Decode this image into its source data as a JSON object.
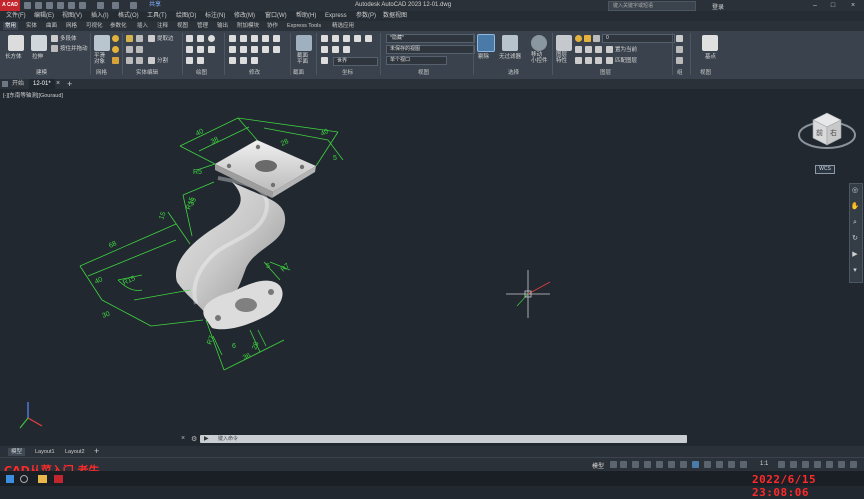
{
  "app": {
    "logo": "A CAD",
    "share": "共享",
    "title": "Autodesk AutoCAD 2023   12-01.dwg",
    "search_placeholder": "键入关键字或短语",
    "login": "登录"
  },
  "menus": [
    "文件(F)",
    "编辑(E)",
    "视图(V)",
    "插入(I)",
    "格式(O)",
    "工具(T)",
    "绘图(D)",
    "标注(N)",
    "修改(M)",
    "窗口(W)",
    "帮助(H)",
    "Express",
    "参数(P)",
    "数据视图"
  ],
  "ribbon_tabs": [
    "常用",
    "实体",
    "曲面",
    "网格",
    "可视化",
    "参数化",
    "插入",
    "注释",
    "视图",
    "管理",
    "输出",
    "附加模块",
    "协作",
    "Express Tools",
    "精选应用"
  ],
  "ribbon": {
    "modeling": {
      "box": "长方体",
      "extrude": "拉伸",
      "polysolid": "多段体",
      "presspull": "按住并拖动",
      "group": "建模"
    },
    "mesh": {
      "smooth": "平滑\n对象",
      "group": "网格"
    },
    "solid_edit": {
      "group": "实体编辑",
      "extract": "提取边",
      "split": "分割"
    },
    "draw": {
      "group": "绘图"
    },
    "modify": {
      "group": "修改"
    },
    "section": {
      "label": "截面\n平面",
      "group": "截面"
    },
    "coords": {
      "group": "坐标",
      "world": "世界"
    },
    "view": {
      "visual_style": "*隐藏*",
      "saved_view": "未保存的视图",
      "viewport": "单个视口",
      "group": "视图"
    },
    "selection": {
      "culling": "剔除",
      "nofilter": "无过滤器",
      "gizmo": "移动\n小控件",
      "group": "选择"
    },
    "layers": {
      "props": "图层\n特性",
      "layer_value": "0",
      "match": "置为当前",
      "match_layer": "匹配图层",
      "group": "图层"
    },
    "groups": {
      "group": "组"
    },
    "view2": {
      "base": "基点",
      "group": "视图"
    }
  },
  "doc_tabs": [
    "开始",
    "12-01*"
  ],
  "viewport_label": "[-][东南等轴测][Gouraud]",
  "viewcube": {
    "face": "前",
    "right": "右",
    "wcs": "WCS"
  },
  "command": {
    "placeholder": "键入命令"
  },
  "layout_tabs": [
    "模型",
    "Layout1",
    "Layout2"
  ],
  "status": {
    "model": "模型",
    "scale": "1:1"
  },
  "overlay_text": "CAD从菜入门 老牛",
  "timestamp": "2022/6/15 23:08:06",
  "dims": [
    "40",
    "38",
    "28",
    "40",
    "R5",
    "5",
    "15",
    "R15",
    "R15",
    "35",
    "30",
    "68",
    "40",
    "5",
    "R7",
    "28",
    "6",
    "36",
    "R7"
  ]
}
